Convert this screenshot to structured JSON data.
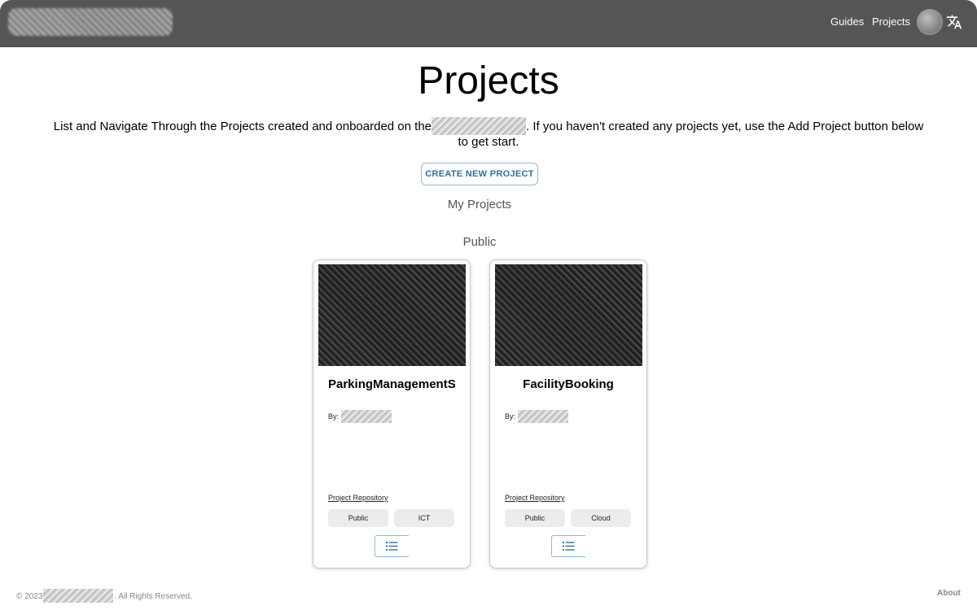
{
  "header": {
    "nav": {
      "guides": "Guides",
      "projects": "Projects"
    },
    "icons": {
      "avatar": "user-avatar",
      "language": "translate-icon"
    }
  },
  "page": {
    "title": "Projects",
    "intro_before": "List and Navigate Through the Projects created and onboarded on the",
    "intro_after": ". If you haven't created any projects yet, use the Add Project button below to get start.",
    "create_button": "CREATE NEW PROJECT",
    "my_projects_label": "My Projects",
    "public_label": "Public"
  },
  "projects": [
    {
      "title": "ParkingManagementSystem",
      "by_label": "By:",
      "repo_link": "Project Repository",
      "tags": [
        "Public",
        "ICT"
      ],
      "list_icon": "list-icon"
    },
    {
      "title": "FacilityBooking",
      "by_label": "By:",
      "repo_link": "Project Repository",
      "tags": [
        "Public",
        "Cloud"
      ],
      "list_icon": "list-icon"
    }
  ],
  "footer": {
    "copyright_prefix": "© 2023",
    "copyright_suffix": ". All Rights Reserved.",
    "about": "About"
  },
  "colors": {
    "header_bg": "#555555",
    "accent": "#2a72a8"
  }
}
